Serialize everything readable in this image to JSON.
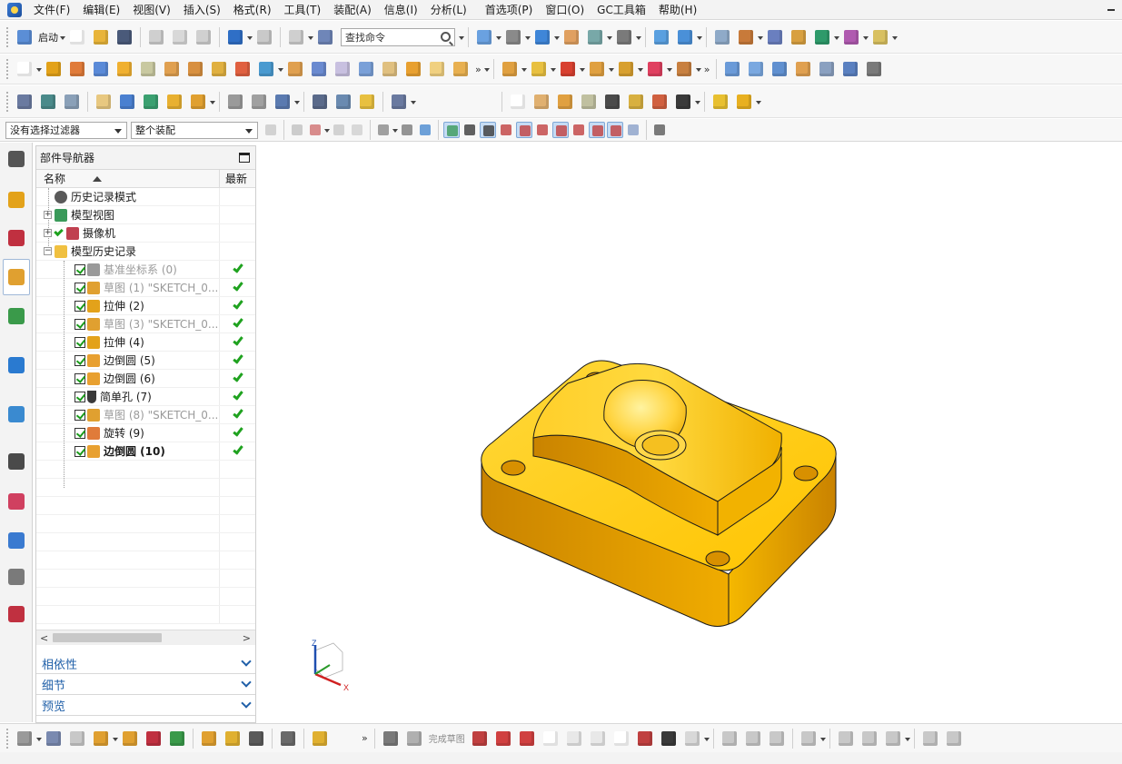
{
  "menu": {
    "items": [
      "文件(F)",
      "编辑(E)",
      "视图(V)",
      "插入(S)",
      "格式(R)",
      "工具(T)",
      "装配(A)",
      "信息(I)",
      "分析(L)",
      "首选项(P)",
      "窗口(O)",
      "GC工具箱",
      "帮助(H)"
    ]
  },
  "toolbar": {
    "start_label": "启动",
    "search_placeholder": "查找命令"
  },
  "selection": {
    "filter_value": "没有选择过滤器",
    "scope_value": "整个装配"
  },
  "navigator": {
    "title": "部件导航器",
    "col_name": "名称",
    "col_latest": "最新",
    "items": [
      {
        "label": "历史记录模式",
        "level": 0,
        "state": "normal",
        "latest": false
      },
      {
        "label": "模型视图",
        "level": 0,
        "state": "normal",
        "latest": false
      },
      {
        "label": "摄像机",
        "level": 0,
        "state": "normal",
        "latest": false
      },
      {
        "label": "模型历史记录",
        "level": 0,
        "state": "normal",
        "latest": false
      },
      {
        "label": "基准坐标系 (0)",
        "level": 1,
        "state": "dim",
        "latest": true
      },
      {
        "label": "草图 (1) \"SKETCH_0...",
        "level": 1,
        "state": "dim",
        "latest": true
      },
      {
        "label": "拉伸 (2)",
        "level": 1,
        "state": "normal",
        "latest": true
      },
      {
        "label": "草图 (3) \"SKETCH_0...",
        "level": 1,
        "state": "dim",
        "latest": true
      },
      {
        "label": "拉伸 (4)",
        "level": 1,
        "state": "normal",
        "latest": true
      },
      {
        "label": "边倒圆 (5)",
        "level": 1,
        "state": "normal",
        "latest": true
      },
      {
        "label": "边倒圆 (6)",
        "level": 1,
        "state": "normal",
        "latest": true
      },
      {
        "label": "简单孔 (7)",
        "level": 1,
        "state": "normal",
        "latest": true
      },
      {
        "label": "草图 (8) \"SKETCH_0...",
        "level": 1,
        "state": "dim",
        "latest": true
      },
      {
        "label": "旋转 (9)",
        "level": 1,
        "state": "normal",
        "latest": true
      },
      {
        "label": "边倒圆 (10)",
        "level": 1,
        "state": "bold",
        "latest": true
      }
    ],
    "sections": [
      "相依性",
      "细节",
      "预览"
    ]
  },
  "bottom": {
    "finish_sketch_label": "完成草图"
  },
  "triad": {
    "z": "Z",
    "x": "X"
  },
  "colors": {
    "part_light": "#ffd21a",
    "part_mid": "#f5b400",
    "part_dark": "#d98e00",
    "part_edge": "#1a1a1a",
    "accent_link": "#1f5fa8",
    "check_green": "#1fa21f"
  }
}
